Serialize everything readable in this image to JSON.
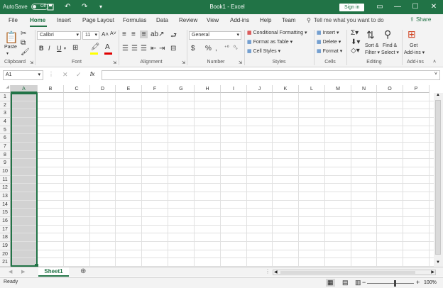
{
  "titlebar": {
    "autosave_label": "AutoSave",
    "autosave_state": "Off",
    "save_icon": "save-icon",
    "undo_icon": "undo-icon",
    "redo_icon": "redo-icon",
    "window_title": "Book1 - Excel",
    "signin_label": "Sign in",
    "minimize": "—",
    "maximize": "☐",
    "close": "✕",
    "accent_color": "#217346"
  },
  "tabs": [
    "File",
    "Home",
    "Insert",
    "Page Layout",
    "Formulas",
    "Data",
    "Review",
    "View",
    "Add-ins",
    "Help",
    "Team"
  ],
  "active_tab": "Home",
  "tellme_placeholder": "Tell me what you want to do",
  "share_label": "Share",
  "ribbon": {
    "clipboard": {
      "label": "Clipboard",
      "paste": "Paste"
    },
    "font": {
      "label": "Font",
      "font_name": "Calibri",
      "font_size": "11",
      "bold": "B",
      "italic": "I",
      "underline": "U"
    },
    "alignment": {
      "label": "Alignment"
    },
    "number": {
      "label": "Number",
      "format": "General",
      "currency": "$",
      "percent": "%",
      "comma": ","
    },
    "styles": {
      "label": "Styles",
      "conditional": "Conditional Formatting",
      "format_table": "Format as Table",
      "cell_styles": "Cell Styles"
    },
    "cells": {
      "label": "Cells",
      "insert": "Insert",
      "delete": "Delete",
      "format": "Format"
    },
    "editing": {
      "label": "Editing",
      "sort_filter_1": "Sort &",
      "sort_filter_2": "Filter",
      "find_select_1": "Find &",
      "find_select_2": "Select"
    },
    "addins": {
      "label": "Add-ins",
      "get_1": "Get",
      "get_2": "Add-ins"
    }
  },
  "formula_bar": {
    "name_box": "A1",
    "fx": "fx",
    "value": ""
  },
  "columns": [
    "A",
    "B",
    "C",
    "D",
    "E",
    "F",
    "G",
    "H",
    "I",
    "J",
    "K",
    "L",
    "M",
    "N",
    "O",
    "P"
  ],
  "rows": [
    "1",
    "2",
    "3",
    "4",
    "5",
    "6",
    "7",
    "8",
    "9",
    "10",
    "11",
    "12",
    "13",
    "14",
    "15",
    "16",
    "17",
    "18",
    "19",
    "20",
    "21"
  ],
  "selected_column": "A",
  "sheets": [
    "Sheet1"
  ],
  "status": {
    "text": "Ready",
    "zoom": "100%"
  }
}
